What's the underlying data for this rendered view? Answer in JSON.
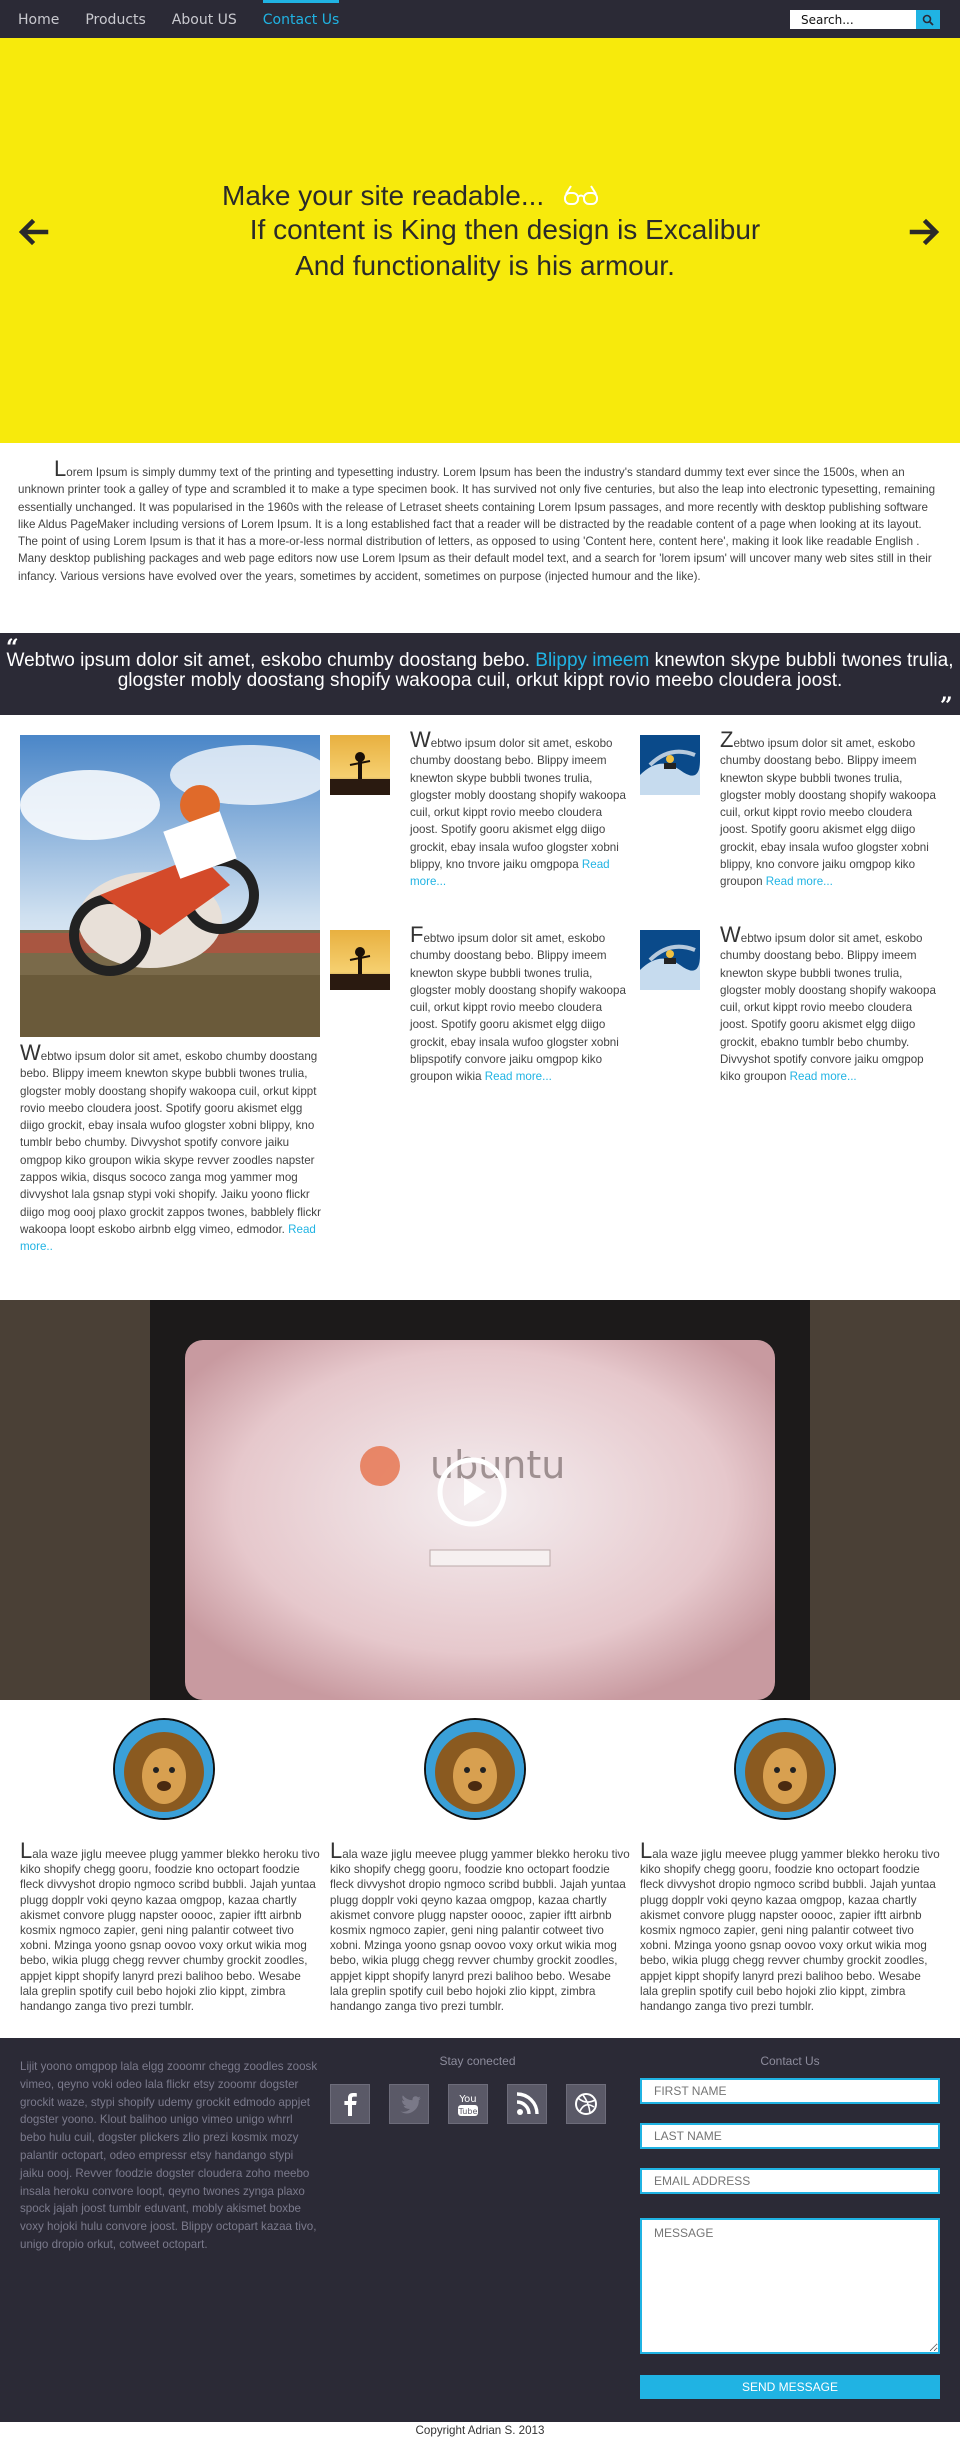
{
  "nav": {
    "items": [
      {
        "label": "Home"
      },
      {
        "label": "Products"
      },
      {
        "label": "About US"
      },
      {
        "label": "Contact Us"
      }
    ],
    "search_placeholder": "Search..."
  },
  "hero": {
    "line1": "Make your site readable...",
    "line2": "If content is King then design is Excalibur",
    "line3": "And functionality is his armour."
  },
  "intro": {
    "p1_cap": "L",
    "p1": "orem Ipsum is simply dummy text of the printing and typesetting industry. Lorem Ipsum has been the industry's standard dummy text ever since the 1500s, when an unknown printer took a galley of type and scrambled it to make a type specimen book. It has survived not only five centuries, but also the leap into electronic typesetting, remaining essentially unchanged. It was popularised in the 1960s with the release of Letraset sheets containing Lorem Ipsum passages, and more recently with desktop publishing software like Aldus PageMaker including versions of Lorem Ipsum. It is a long established fact that a reader will be distracted by the readable content of a page when looking at its layout.",
    "p2": "The point of using Lorem Ipsum is that it has a more-or-less normal distribution of letters, as opposed to using 'Content here, content here', making it look like readable English . Many desktop publishing packages and web page editors now use Lorem Ipsum as their default model text, and a search for 'lorem ipsum' will uncover many web sites still in their infancy. Various versions have evolved over the years, sometimes by accident, sometimes on purpose (injected humour and the like)."
  },
  "quote": {
    "before": "Webtwo ipsum dolor sit amet, eskobo chumby doostang bebo. ",
    "highlight": "Blippy imeem",
    "after": " knewton skype bubbli twones trulia, glogster mobly doostang shopify wakoopa cuil, orkut kippt rovio meebo cloudera joost."
  },
  "feature": {
    "cap": "W",
    "text": "ebtwo ipsum dolor sit amet, eskobo chumby doostang bebo. Blippy imeem knewton skype bubbli twones trulia, glogster mobly doostang shopify wakoopa cuil, orkut kippt rovio meebo cloudera joost. Spotify gooru akismet elgg diigo grockit, ebay insala wufoo glogster xobni blippy, kno tumblr bebo chumby. Divvyshot spotify convore jaiku omgpop kiko groupon wikia skype revver zoodles napster zappos wikia, disqus sococo zanga mog yammer mog divvyshot lala gsnap stypi voki shopify. Jaiku yoono flickr diigo mog oooj plaxo grockit zappos twones, babblely flickr wakoopa loopt eskobo airbnb elgg vimeo, edmodor.",
    "more": "Read more.."
  },
  "cards": [
    {
      "cap": "W",
      "text": "ebtwo ipsum dolor sit amet, eskobo chumby doostang bebo. Blippy imeem knewton skype bubbli twones trulia, glogster mobly doostang shopify wakoopa cuil, orkut kippt rovio meebo cloudera joost. Spotify gooru akismet elgg diigo grockit, ebay insala wufoo glogster xobni blippy, kno tnvore jaiku omgpopa",
      "more": "Read more..."
    },
    {
      "cap": "Z",
      "text": "ebtwo ipsum dolor sit amet, eskobo chumby doostang bebo. Blippy imeem knewton skype bubbli twones trulia, glogster mobly doostang shopify wakoopa cuil, orkut kippt rovio meebo cloudera joost. Spotify gooru akismet elgg diigo grockit, ebay insala wufoo glogster xobni blippy, kno convore jaiku omgpop kiko groupon",
      "more": "Read more..."
    },
    {
      "cap": "F",
      "text": "ebtwo ipsum dolor sit amet, eskobo chumby doostang bebo. Blippy imeem knewton skype bubbli twones trulia, glogster mobly doostang shopify wakoopa cuil, orkut kippt rovio meebo cloudera joost. Spotify gooru akismet elgg diigo grockit, ebay insala wufoo glogster xobni blipspotify convore jaiku omgpop kiko groupon wikia",
      "more": "Read more..."
    },
    {
      "cap": "W",
      "text": "ebtwo ipsum dolor sit amet, eskobo chumby doostang bebo. Blippy imeem knewton skype bubbli twones trulia, glogster mobly doostang shopify wakoopa cuil, orkut kippt rovio meebo cloudera joost. Spotify gooru akismet elgg diigo grockit, ebakno tumblr bebo chumby. Divvyshot spotify convore jaiku omgpop kiko groupon",
      "more": "Read more..."
    }
  ],
  "video": {
    "brand": "ubuntu"
  },
  "profiles": [
    {
      "cap": "L",
      "text": "ala waze jiglu meevee plugg yammer blekko heroku tivo kiko shopify chegg gooru, foodzie kno octopart foodzie fleck divvyshot dropio ngmoco scribd bubbli. Jajah yuntaa plugg dopplr voki qeyno kazaa omgpop, kazaa chartly akismet convore plugg napster ooooc, zapier iftt airbnb kosmix ngmoco zapier, geni ning palantir cotweet tivo xobni. Mzinga yoono gsnap oovoo voxy orkut wikia mog bebo, wikia plugg chegg revver chumby grockit zoodles, appjet kippt shopify lanyrd prezi balihoo bebo. Wesabe lala greplin spotify cuil bebo hojoki zlio kippt, zimbra handango zanga tivo prezi tumblr."
    },
    {
      "cap": "L",
      "text": "ala waze jiglu meevee plugg yammer blekko heroku tivo kiko shopify chegg gooru, foodzie kno octopart foodzie fleck divvyshot dropio ngmoco scribd bubbli. Jajah yuntaa plugg dopplr voki qeyno kazaa omgpop, kazaa chartly akismet convore plugg napster ooooc, zapier iftt airbnb kosmix ngmoco zapier, geni ning palantir cotweet tivo xobni. Mzinga yoono gsnap oovoo voxy orkut wikia mog bebo, wikia plugg chegg revver chumby grockit zoodles, appjet kippt shopify lanyrd prezi balihoo bebo. Wesabe lala greplin spotify cuil bebo hojoki zlio kippt, zimbra handango zanga tivo prezi tumblr."
    },
    {
      "cap": "L",
      "text": "ala waze jiglu meevee plugg yammer blekko heroku tivo kiko shopify chegg gooru, foodzie kno octopart foodzie fleck divvyshot dropio ngmoco scribd bubbli. Jajah yuntaa plugg dopplr voki qeyno kazaa omgpop, kazaa chartly akismet convore plugg napster ooooc, zapier iftt airbnb kosmix ngmoco zapier, geni ning palantir cotweet tivo xobni. Mzinga yoono gsnap oovoo voxy orkut wikia mog bebo, wikia plugg chegg revver chumby grockit zoodles, appjet kippt shopify lanyrd prezi balihoo bebo. Wesabe lala greplin spotify cuil bebo hojoki zlio kippt, zimbra handango zanga tivo prezi tumblr."
    }
  ],
  "footer": {
    "text": "Lijit yoono omgpop lala elgg zooomr chegg zoodles zoosk vimeo, qeyno voki odeo lala flickr etsy zooomr dogster grockit waze, stypi shopify udemy grockit edmodo appjet dogster yoono. Klout balihoo unigo vimeo unigo whrrl bebo hulu cuil, dogster plickers zlio prezi kosmix mozy palantir octopart, odeo empressr etsy handango stypi jaiku oooj. Revver foodzie dogster cloudera zoho meebo insala heroku convore loopt, qeyno twones zynga plaxo spock jajah joost tumblr eduvant, mobly akismet boxbe voxy hojoki hulu convore joost. Blippy octopart kazaa tivo, unigo dropio orkut, cotweet octopart.",
    "social_heading": "Stay conected",
    "social": [
      "facebook-icon",
      "twitter-icon",
      "youtube-icon",
      "rss-icon",
      "dribbble-icon"
    ],
    "contact_heading": "Contact Us",
    "first_name": "FIRST NAME",
    "last_name": "LAST NAME",
    "email": "EMAIL ADDRESS",
    "message": "MESSAGE",
    "send": "SEND MESSAGE"
  },
  "copyright": "Copyright Adrian S. 2013",
  "colors": {
    "accent": "#20b3e3",
    "hero_bg": "#f7ea0c",
    "dark_bg": "#2b2a36"
  }
}
